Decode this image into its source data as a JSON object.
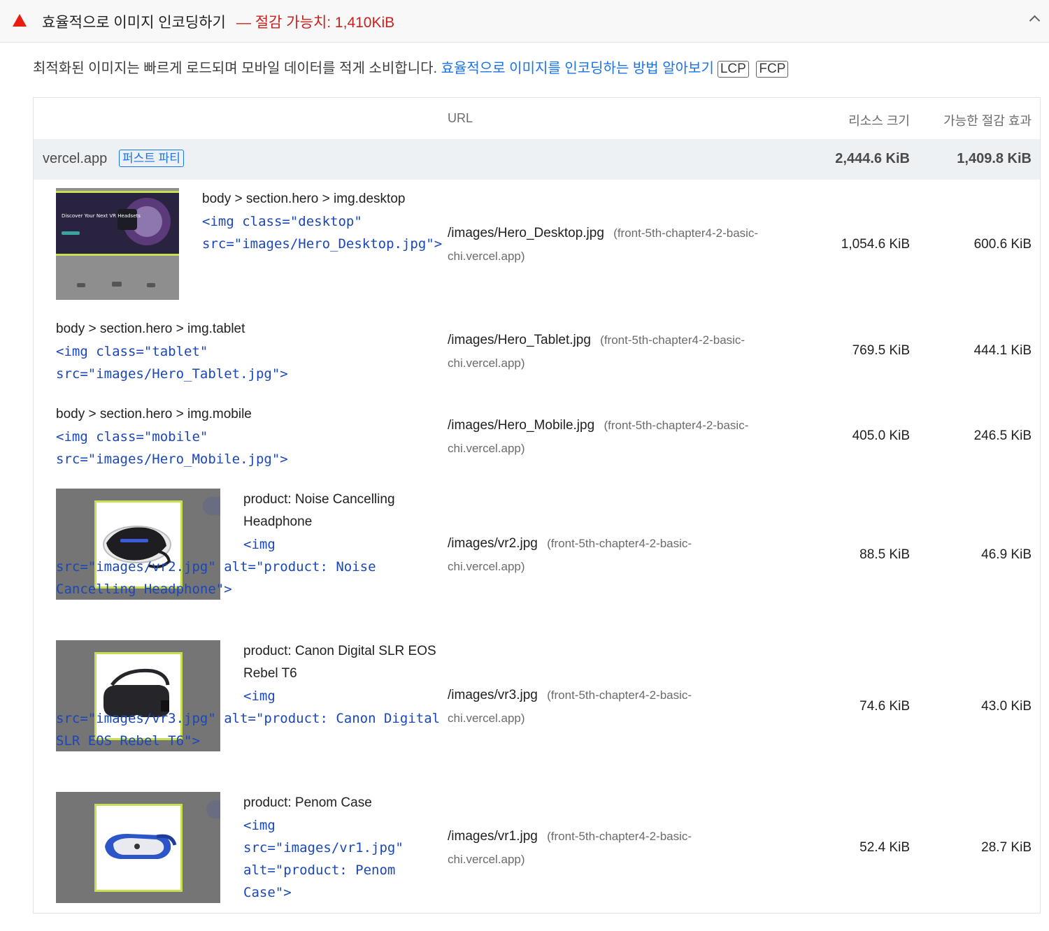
{
  "header": {
    "title": "효율적으로 이미지 인코딩하기",
    "savings": "— 절감 가능치: 1,410KiB",
    "warn_icon": "warning-triangle-icon",
    "collapse_icon": "chevron-up-icon"
  },
  "description": {
    "text": "최적화된 이미지는 빠르게 로드되며 모바일 데이터를 적게 소비합니다.",
    "link": "효율적으로 이미지를 인코딩하는 방법 알아보기",
    "tags": [
      "LCP",
      "FCP"
    ]
  },
  "table": {
    "columns": {
      "url": "URL",
      "size": "리소스 크기",
      "savings": "가능한 절감 효과"
    },
    "group": {
      "name": "vercel.app",
      "badge": "퍼스트 파티",
      "size": "2,444.6 KiB",
      "savings": "1,409.8 KiB"
    },
    "rows": [
      {
        "selector": "body > section.hero > img.desktop",
        "snippet": "<img class=\"desktop\" src=\"images/Hero_Desktop.jpg\">",
        "url": "/images/Hero_Desktop.jpg",
        "origin": "(front-5th-chapter4-2-basic-chi.vercel.app)",
        "size": "1,054.6 KiB",
        "savings": "600.6 KiB",
        "thumb_text": "Discover Your Next VR Headsets"
      },
      {
        "selector": "body > section.hero > img.tablet",
        "snippet": "<img class=\"tablet\" src=\"images/Hero_Tablet.jpg\">",
        "url": "/images/Hero_Tablet.jpg",
        "origin": "(front-5th-chapter4-2-basic-chi.vercel.app)",
        "size": "769.5 KiB",
        "savings": "444.1 KiB"
      },
      {
        "selector": "body > section.hero > img.mobile",
        "snippet": "<img class=\"mobile\" src=\"images/Hero_Mobile.jpg\">",
        "url": "/images/Hero_Mobile.jpg",
        "origin": "(front-5th-chapter4-2-basic-chi.vercel.app)",
        "size": "405.0 KiB",
        "savings": "246.5 KiB"
      },
      {
        "selector": "product: Noise Cancelling Headphone",
        "snippet": "<img src=\"images/vr2.jpg\" alt=\"product: Noise Cancelling Headphone\">",
        "url": "/images/vr2.jpg",
        "origin": "(front-5th-chapter4-2-basic-chi.vercel.app)",
        "size": "88.5 KiB",
        "savings": "46.9 KiB"
      },
      {
        "selector": "product: Canon Digital SLR EOS Rebel T6",
        "snippet": "<img src=\"images/vr3.jpg\" alt=\"product: Canon Digital SLR EOS Rebel T6\">",
        "url": "/images/vr3.jpg",
        "origin": "(front-5th-chapter4-2-basic-chi.vercel.app)",
        "size": "74.6 KiB",
        "savings": "43.0 KiB"
      },
      {
        "selector": "product: Penom Case",
        "snippet": "<img src=\"images/vr1.jpg\" alt=\"product: Penom Case\">",
        "url": "/images/vr1.jpg",
        "origin": "(front-5th-chapter4-2-basic-chi.vercel.app)",
        "size": "52.4 KiB",
        "savings": "28.7 KiB"
      }
    ]
  },
  "colors": {
    "warning": "#eb1c0f",
    "savings_text": "#c7221f",
    "link": "#1a73e8",
    "snippet": "#1a47b8",
    "group_bg": "#eef1f4",
    "thumb_frame": "#c9df52"
  }
}
